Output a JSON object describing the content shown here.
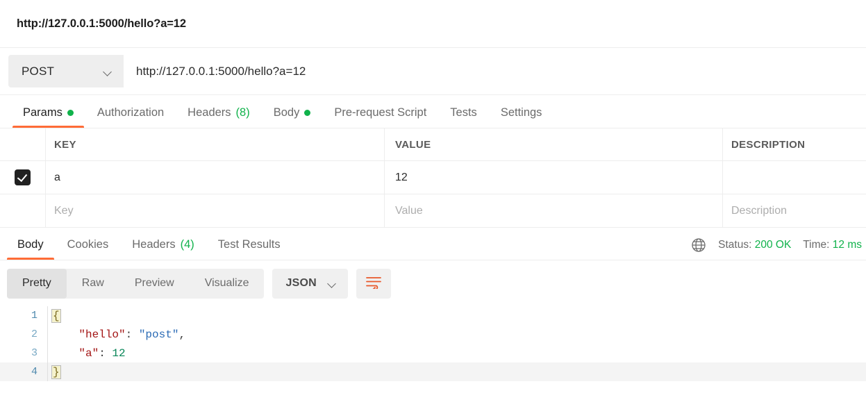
{
  "request": {
    "title": "http://127.0.0.1:5000/hello?a=12",
    "method": "POST",
    "url": "http://127.0.0.1:5000/hello?a=12",
    "tabs": [
      {
        "label": "Params",
        "badge": "dot",
        "active": true
      },
      {
        "label": "Authorization",
        "badge": "",
        "active": false
      },
      {
        "label": "Headers",
        "badge": "(8)",
        "active": false
      },
      {
        "label": "Body",
        "badge": "dot",
        "active": false
      },
      {
        "label": "Pre-request Script",
        "badge": "",
        "active": false
      },
      {
        "label": "Tests",
        "badge": "",
        "active": false
      },
      {
        "label": "Settings",
        "badge": "",
        "active": false
      }
    ]
  },
  "params": {
    "headers": {
      "key": "KEY",
      "value": "VALUE",
      "description": "DESCRIPTION"
    },
    "rows": [
      {
        "checked": true,
        "key": "a",
        "value": "12",
        "description": ""
      }
    ],
    "placeholders": {
      "key": "Key",
      "value": "Value",
      "description": "Description"
    }
  },
  "response": {
    "tabs": [
      {
        "label": "Body",
        "badge": "",
        "active": true
      },
      {
        "label": "Cookies",
        "badge": "",
        "active": false
      },
      {
        "label": "Headers",
        "badge": "(4)",
        "active": false
      },
      {
        "label": "Test Results",
        "badge": "",
        "active": false
      }
    ],
    "status_label": "Status:",
    "status_value": "200 OK",
    "time_label": "Time:",
    "time_value": "12 ms",
    "view_modes": [
      {
        "label": "Pretty",
        "active": true
      },
      {
        "label": "Raw",
        "active": false
      },
      {
        "label": "Preview",
        "active": false
      },
      {
        "label": "Visualize",
        "active": false
      }
    ],
    "format": "JSON",
    "body_lines": [
      {
        "num": "1",
        "active": false
      },
      {
        "num": "2",
        "active": false
      },
      {
        "num": "3",
        "active": false
      },
      {
        "num": "4",
        "active": true
      }
    ],
    "body_tokens": {
      "open_brace": "{",
      "key_hello": "\"hello\"",
      "colon1": ": ",
      "val_post": "\"post\"",
      "comma": ",",
      "key_a": "\"a\"",
      "colon2": ": ",
      "val_12": "12",
      "close_brace": "}",
      "indent": "    "
    }
  },
  "colors": {
    "accent": "#ff6c37",
    "success": "#10b24b",
    "json_key": "#a31515",
    "json_string": "#2b6bb5",
    "json_number": "#098658"
  }
}
